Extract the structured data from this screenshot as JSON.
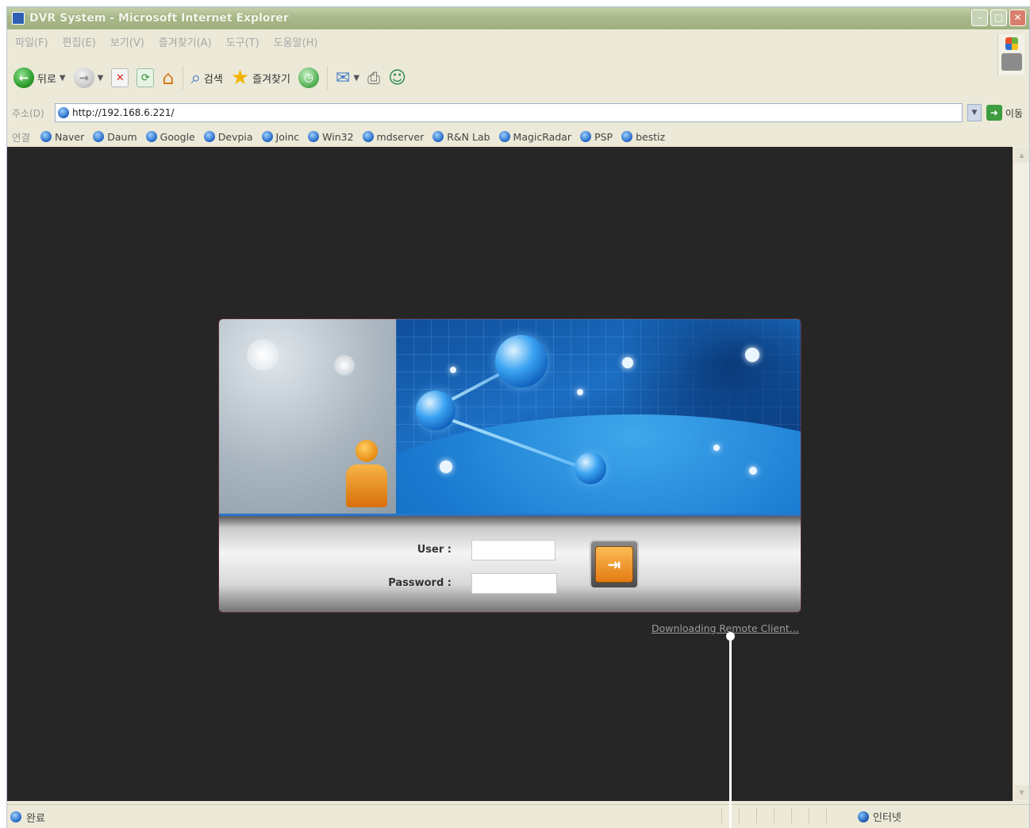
{
  "window": {
    "title": "DVR System - Microsoft Internet Explorer"
  },
  "menu": [
    "파일(F)",
    "편집(E)",
    "보기(V)",
    "즐겨찾기(A)",
    "도구(T)",
    "도움말(H)"
  ],
  "toolbar": {
    "back_label": "뒤로",
    "search_label": "검색",
    "favorites_label": "즐겨찾기"
  },
  "address": {
    "label": "주소(D)",
    "url": "http://192.168.6.221/",
    "go_label": "이동"
  },
  "links": {
    "label": "연결",
    "items": [
      "Naver",
      "Daum",
      "Google",
      "Devpia",
      "Joinc",
      "Win32",
      "mdserver",
      "R&N Lab",
      "MagicRadar",
      "PSP",
      "bestiz"
    ]
  },
  "login": {
    "user_label": "User :",
    "user_value": "",
    "password_label": "Password :",
    "password_value": "",
    "download_link": "Downloading Remote Client..."
  },
  "status": {
    "text": "완료",
    "zone": "인터넷"
  },
  "colors": {
    "content_bg": "#262626",
    "accent": "#2b74c7",
    "button": "#e27b12"
  }
}
